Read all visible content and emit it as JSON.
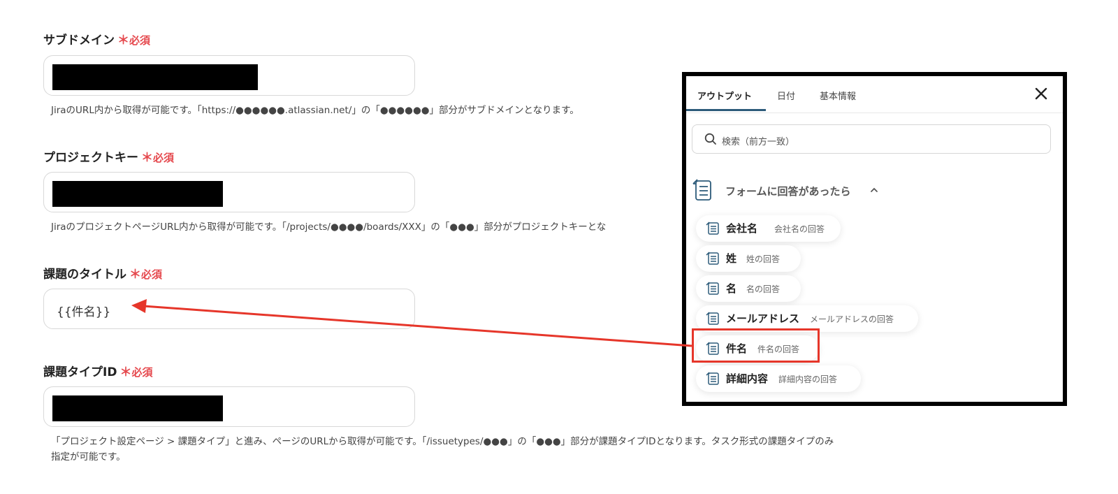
{
  "form": {
    "fields": [
      {
        "label": "サブドメイン",
        "required": "必須",
        "value": "",
        "help": "JiraのURL内から取得が可能です。「https://●●●●●●.atlassian.net/」の「●●●●●●」部分がサブドメインとなります。"
      },
      {
        "label": "プロジェクトキー",
        "required": "必須",
        "value": "",
        "help": "JiraのプロジェクトページURL内から取得が可能です。「/projects/●●●●/boards/XXX」の「●●●」部分がプロジェクトキーとな"
      },
      {
        "label": "課題のタイトル",
        "required": "必須",
        "value": "{{件名}}"
      },
      {
        "label": "課題タイプID",
        "required": "必須",
        "value": "",
        "help_line1": "「プロジェクト設定ページ > 課題タイプ」と進み、ページのURLから取得が可能です。「/issuetypes/●●●」の「●●●」部分が課題タイプIDとなります。タスク形式の課題タイプのみ",
        "help_line2": "指定が可能です。"
      }
    ]
  },
  "popup": {
    "tabs": [
      "アウトプット",
      "日付",
      "基本情報"
    ],
    "active_tab": "アウトプット",
    "search_placeholder": "検索（前方一致）",
    "group_title": "フォームに回答があったら",
    "items": [
      {
        "name": "会社名",
        "sub": "会社名の回答"
      },
      {
        "name": "姓",
        "sub": "姓の回答"
      },
      {
        "name": "名",
        "sub": "名の回答"
      },
      {
        "name": "メールアドレス",
        "sub": "メールアドレスの回答"
      },
      {
        "name": "件名",
        "sub": "件名の回答"
      },
      {
        "name": "詳細内容",
        "sub": "詳細内容の回答"
      }
    ]
  },
  "colors": {
    "required": "#e5484d",
    "annotation": "#e6362a",
    "tab_accent": "#2d5b7a"
  }
}
